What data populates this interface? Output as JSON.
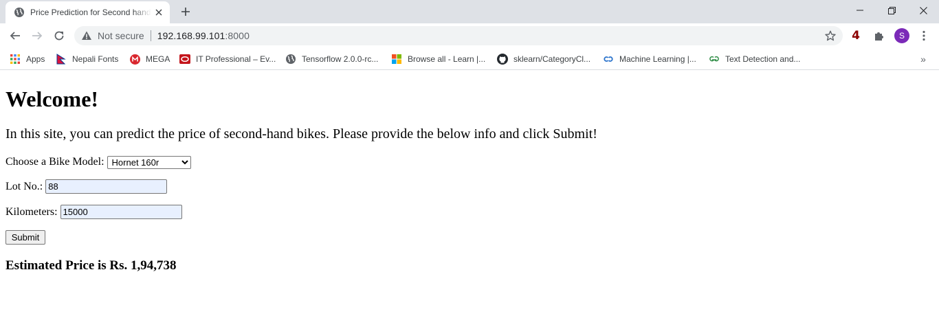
{
  "browser": {
    "tab": {
      "title": "Price Prediction for Second hand Bikes"
    },
    "omnibox": {
      "security_label": "Not secure",
      "url_host": "192.168.99.101",
      "url_port": ":8000"
    },
    "extension_badge": "4",
    "profile_initial": "S",
    "bookmarks": [
      {
        "label": "Apps",
        "icon": "apps-grid-icon"
      },
      {
        "label": "Nepali Fonts",
        "icon": "nepal-flag-icon"
      },
      {
        "label": "MEGA",
        "icon": "mega-icon"
      },
      {
        "label": "IT Professional – Ev...",
        "icon": "it-professional-icon"
      },
      {
        "label": "Tensorflow 2.0.0-rc...",
        "icon": "globe-icon"
      },
      {
        "label": "Browse all - Learn |...",
        "icon": "microsoft-icon"
      },
      {
        "label": "sklearn/CategoryCl...",
        "icon": "github-icon"
      },
      {
        "label": "Machine Learning |...",
        "icon": "coursera-icon"
      },
      {
        "label": "Text Detection and...",
        "icon": "geeksforgeeks-icon"
      }
    ],
    "bookmarks_overflow": "»"
  },
  "page": {
    "heading": "Welcome!",
    "intro": "In this site, you can predict the price of second-hand bikes. Please provide the below info and click Submit!",
    "bike_model_label": "Choose a Bike Model:",
    "bike_model_selected": "Hornet 160r",
    "lot_label": "Lot No.:",
    "lot_value": "88",
    "km_label": "Kilometers:",
    "km_value": "15000",
    "submit_label": "Submit",
    "result": "Estimated Price is Rs. 1,94,738"
  },
  "colors": {
    "tabstrip_bg": "#dee1e6",
    "omnibox_bg": "#f1f3f4",
    "autofill_bg": "#e8f0fe",
    "avatar_bg": "#7b2ab8",
    "extension_badge": "#8b0000"
  }
}
